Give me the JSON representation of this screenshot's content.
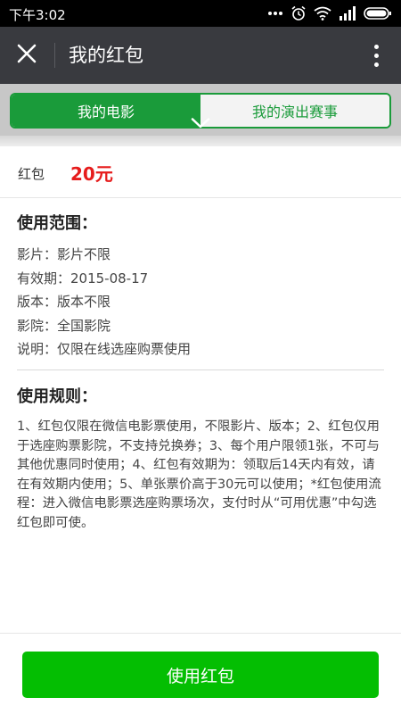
{
  "status_bar": {
    "time": "下午3:02",
    "icons": [
      "more-dots-icon",
      "alarm-icon",
      "wifi-icon",
      "signal-icon",
      "battery-icon"
    ]
  },
  "header": {
    "title": "我的红包",
    "close_icon": "close-icon",
    "more_icon": "more-vertical-icon",
    "background": "#393a3f"
  },
  "tabs": [
    {
      "label": "我的电影",
      "active": true
    },
    {
      "label": "我的演出赛事",
      "active": false
    }
  ],
  "tab_accent": "#1a9b3a",
  "red_packet": {
    "label": "红包",
    "amount": "20元",
    "amount_color": "#e61c1c"
  },
  "scope": {
    "title": "使用范围：",
    "lines": [
      "影片：影片不限",
      "有效期：2015-08-17",
      "版本：版本不限",
      "影院：全国影院",
      "说明：仅限在线选座购票使用"
    ]
  },
  "rules": {
    "title": "使用规则：",
    "text": "1、红包仅限在微信电影票使用，不限影片、版本；2、红包仅用于选座购票影院，不支持兑换券；3、每个用户限领1张，不可与其他优惠同时使用；4、红包有效期为：领取后14天内有效，请在有效期内使用；5、单张票价高于30元可以使用；*红包使用流程：进入微信电影票选座购票场次，支付时从“可用优惠”中勾选红包即可使。"
  },
  "action": {
    "button_label": "使用红包",
    "button_color": "#04be02"
  }
}
